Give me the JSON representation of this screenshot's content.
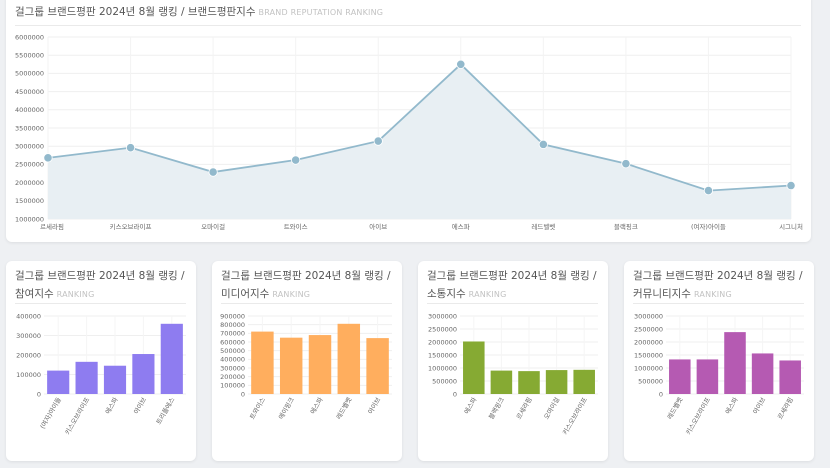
{
  "main_chart": {
    "title": "걸그룹 브랜드평판 2024년 8월 랭킹 / 브랜드평판지수",
    "subtitle": "BRAND REPUTATION RANKING"
  },
  "small_charts": [
    {
      "title": "걸그룹 브랜드평판 2024년 8월 랭킹 / 참여지수",
      "subtitle": "RANKING"
    },
    {
      "title": "걸그룹 브랜드평판 2024년 8월 랭킹 / 미디어지수",
      "subtitle": "RANKING"
    },
    {
      "title": "걸그룹 브랜드평판 2024년 8월 랭킹 / 소통지수",
      "subtitle": "RANKING"
    },
    {
      "title": "걸그룹 브랜드평판 2024년 8월 랭킹 / 커뮤니티지수",
      "subtitle": "RANKING"
    }
  ],
  "chart_data": [
    {
      "type": "area",
      "title": "걸그룹 브랜드평판 2024년 8월 랭킹 / 브랜드평판지수",
      "subtitle": "BRAND REPUTATION RANKING",
      "categories": [
        "르세라핌",
        "키스오브라이프",
        "오마이걸",
        "트와이스",
        "아이브",
        "에스파",
        "레드벨벳",
        "블랙핑크",
        "(여자)아이들",
        "시그니처"
      ],
      "values": [
        2680000,
        2960000,
        2290000,
        2620000,
        3140000,
        5250000,
        3050000,
        2520000,
        1780000,
        1920000
      ],
      "ylim": [
        1000000,
        6000000
      ],
      "yticks": [
        "6000000",
        "5500000",
        "5000000",
        "4500000",
        "4000000",
        "3500000",
        "3000000",
        "2500000",
        "2000000",
        "1500000",
        "1000000"
      ],
      "grid": true,
      "color": "#92b9cc",
      "fill": "#e8eff3"
    },
    {
      "type": "bar",
      "title": "걸그룹 브랜드평판 2024년 8월 랭킹 / 참여지수",
      "subtitle": "RANKING",
      "categories": [
        "(여자)아이들",
        "키스오브라이프",
        "에스파",
        "아이브",
        "트리플에스"
      ],
      "values": [
        120000,
        165000,
        145000,
        205000,
        360000
      ],
      "ylim": [
        0,
        400000
      ],
      "yticks": [
        "400000",
        "300000",
        "200000",
        "100000",
        "0"
      ],
      "color": "#8e7cf0"
    },
    {
      "type": "bar",
      "title": "걸그룹 브랜드평판 2024년 8월 랭킹 / 미디어지수",
      "subtitle": "RANKING",
      "categories": [
        "트와이스",
        "에이핑크",
        "에스파",
        "레드벨벳",
        "아이브"
      ],
      "values": [
        720000,
        650000,
        680000,
        810000,
        645000
      ],
      "ylim": [
        0,
        900000
      ],
      "yticks": [
        "900000",
        "800000",
        "700000",
        "600000",
        "500000",
        "400000",
        "300000",
        "200000",
        "100000",
        "0"
      ],
      "color": "#ffae5e"
    },
    {
      "type": "bar",
      "title": "걸그룹 브랜드평판 2024년 8월 랭킹 / 소통지수",
      "subtitle": "RANKING",
      "categories": [
        "에스파",
        "블랙핑크",
        "르세라핌",
        "오마이걸",
        "키스오브라이프"
      ],
      "values": [
        2020000,
        900000,
        880000,
        920000,
        930000
      ],
      "ylim": [
        0,
        3000000
      ],
      "yticks": [
        "3000000",
        "2500000",
        "2000000",
        "1500000",
        "1000000",
        "500000",
        "0"
      ],
      "color": "#86aa33"
    },
    {
      "type": "bar",
      "title": "걸그룹 브랜드평판 2024년 8월 랭킹 / 커뮤니티지수",
      "subtitle": "RANKING",
      "categories": [
        "레드벨벳",
        "키스오브라이프",
        "에스파",
        "아이브",
        "르세라핌"
      ],
      "values": [
        1330000,
        1330000,
        2380000,
        1560000,
        1290000
      ],
      "ylim": [
        0,
        3000000
      ],
      "yticks": [
        "3000000",
        "2500000",
        "2000000",
        "1500000",
        "1000000",
        "500000",
        "0"
      ],
      "color": "#b55ab2"
    }
  ]
}
